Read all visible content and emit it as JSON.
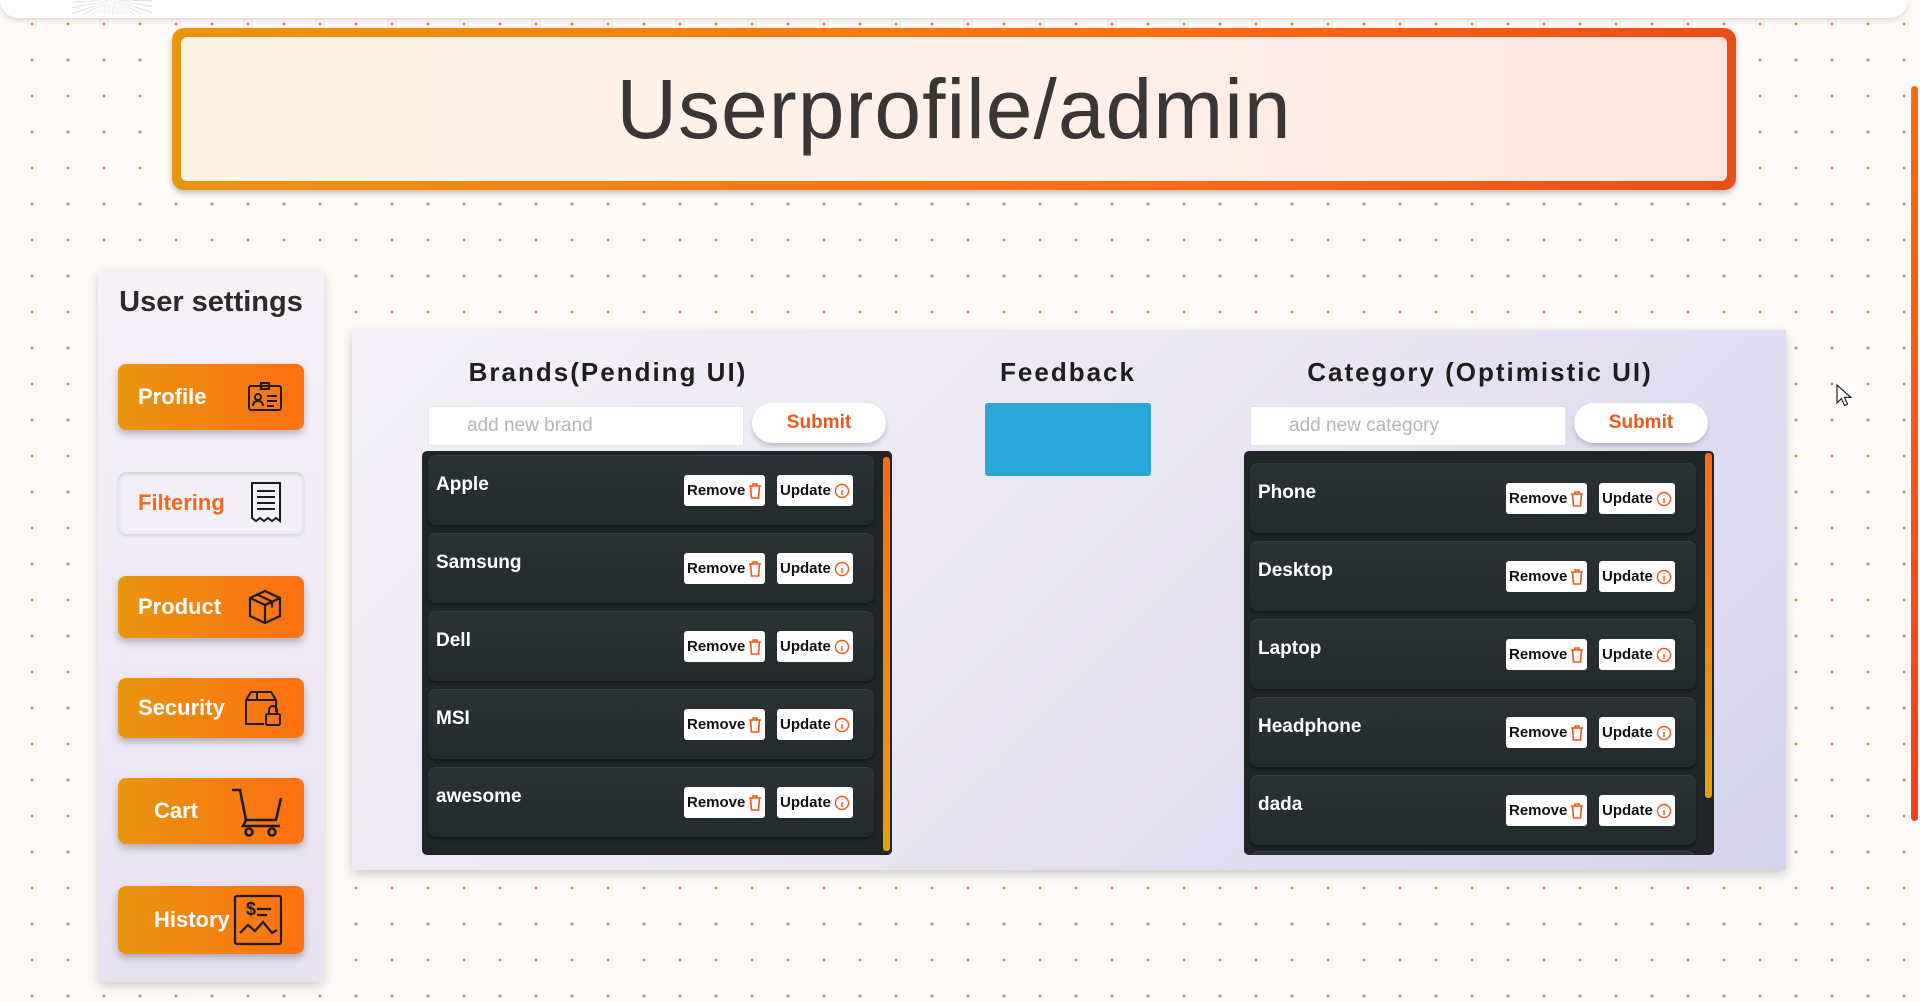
{
  "page": {
    "title": "Userprofile/admin"
  },
  "sidebar": {
    "heading": "User settings",
    "items": [
      {
        "label": "Profile",
        "icon": "id-card-icon",
        "active": false
      },
      {
        "label": "Filtering",
        "icon": "receipt-icon",
        "active": true
      },
      {
        "label": "Product",
        "icon": "box-icon",
        "active": false
      },
      {
        "label": "Security",
        "icon": "lock-box-icon",
        "active": false
      },
      {
        "label": "Cart",
        "icon": "cart-icon",
        "active": false
      },
      {
        "label": "History",
        "icon": "money-history-icon",
        "active": false
      }
    ]
  },
  "brands": {
    "title": "Brands(Pending UI)",
    "placeholder": "add new brand",
    "submit_label": "Submit",
    "items": [
      "Apple",
      "Samsung",
      "Dell",
      "MSI",
      "awesome"
    ]
  },
  "feedback": {
    "title": "Feedback"
  },
  "category": {
    "title": "Category (Optimistic UI)",
    "placeholder": "add new category",
    "submit_label": "Submit",
    "items": [
      "Phone",
      "Desktop",
      "Laptop",
      "Headphone",
      "dada"
    ]
  },
  "row_actions": {
    "remove_label": "Remove",
    "update_label": "Update"
  },
  "colors": {
    "accent": "#ff6f12",
    "accent_start": "#e8950f",
    "feedback": "#2aa7d6",
    "list_bg": "#202628"
  }
}
